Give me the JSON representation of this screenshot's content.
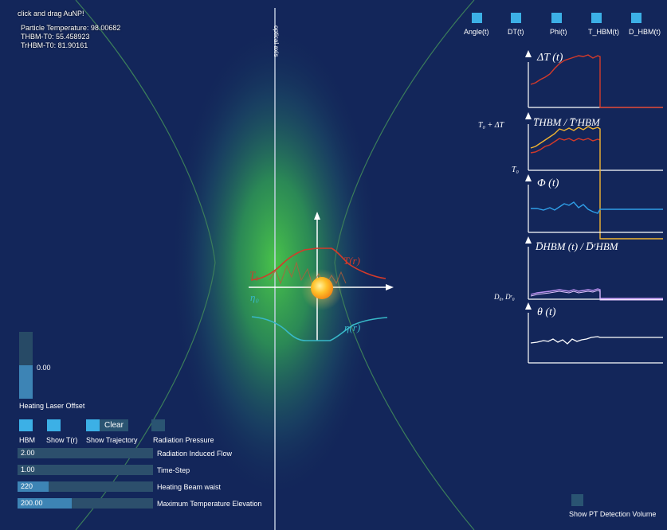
{
  "hud": {
    "hint": "click and drag AuNP!",
    "particle_temperature": "Particle Temperature: 98.00682",
    "thbm": "THBM-T0: 55.458923",
    "trhbm": "TrHBM-T0: 81.90161"
  },
  "optical_axis_label": "optical axis",
  "center_labels": {
    "T0": "T₀",
    "Tr": "T(r)",
    "eta0": "η₀",
    "etar": "η(r)"
  },
  "plot_toggles": [
    {
      "label": "Angle(t)",
      "on": true
    },
    {
      "label": "DT(t)",
      "on": true
    },
    {
      "label": "Phi(t)",
      "on": true
    },
    {
      "label": "T_HBM(t)",
      "on": true
    },
    {
      "label": "D_HBM(t)",
      "on": true
    }
  ],
  "panels": {
    "dT": "ΔT (t)",
    "t_hbm": "T̅HBM / T̅ʳHBM",
    "t0_plus_dT": "T₀ + ΔT",
    "t0": "T₀",
    "phi": "Φ (t)",
    "d_hbm": "D̅HBM (t) / D̅ʳHBM",
    "d0": "D₀, Dʳ₀",
    "theta": "θ (t)"
  },
  "heating_laser_offset": {
    "label": "Heating Laser Offset",
    "value": "0.00",
    "fraction": 0.5
  },
  "bottom_toggles": [
    {
      "label": "HBM",
      "on": true
    },
    {
      "label": "Show T(r)",
      "on": true
    },
    {
      "label": "Show Trajectory",
      "on": true
    },
    {
      "label": "Radiation Pressure",
      "on": false
    }
  ],
  "clear_label": "Clear",
  "sliders": [
    {
      "value": "2.00",
      "label": "Radiation Induced Flow",
      "fraction": 0.0
    },
    {
      "value": "1.00",
      "label": "Time-Step",
      "fraction": 0.0
    },
    {
      "value": "220",
      "label": "Heating Beam waist",
      "fraction": 0.23
    },
    {
      "value": "200.00",
      "label": "Maximum Temperature Elevation",
      "fraction": 0.4
    }
  ],
  "pt_volume": {
    "label": "Show PT Detection Volume",
    "on": false
  },
  "colors": {
    "background": "#13265a",
    "beam": "#3fbb44",
    "toggle_on": "#3cb0e6",
    "toggle_off": "#2a5472",
    "curve_red": "#d43a2a",
    "curve_yellow": "#f2b531",
    "curve_blue": "#2f9fe8",
    "curve_purple": "#b98ff0",
    "curve_white": "#ffffff",
    "profile_teal": "#38b8c8"
  }
}
